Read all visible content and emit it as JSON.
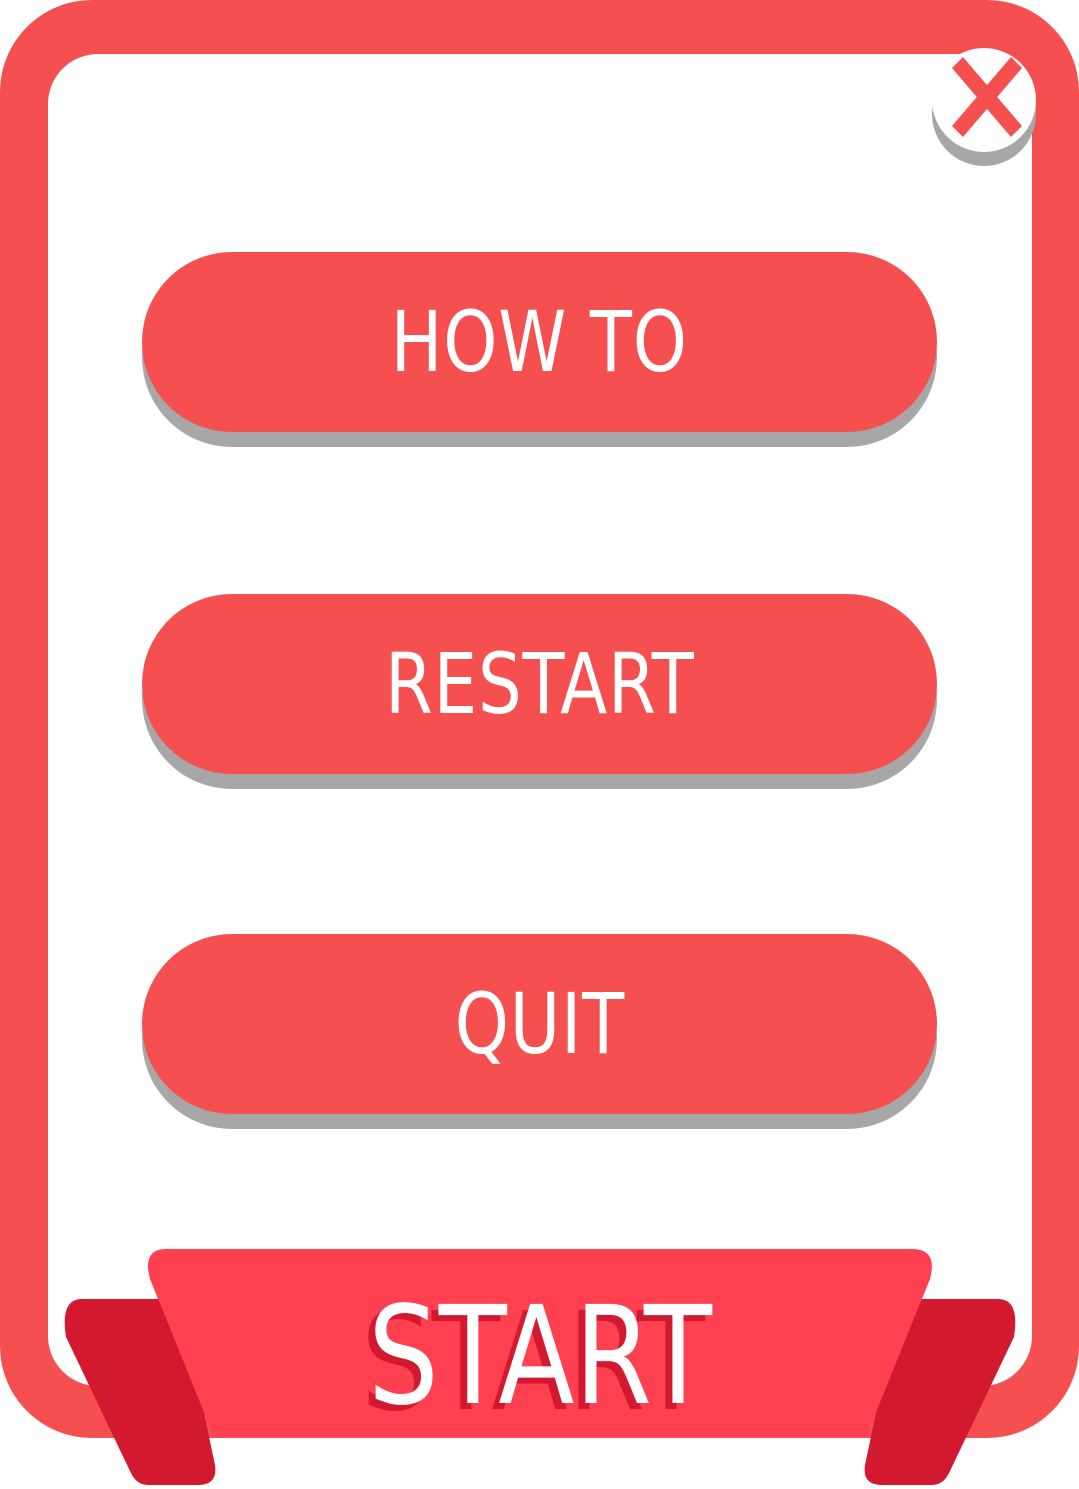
{
  "menu": {
    "buttons": [
      {
        "label": "HOW TO"
      },
      {
        "label": "RESTART"
      },
      {
        "label": "QUIT"
      }
    ]
  },
  "banner": {
    "label": "START"
  },
  "close": {
    "icon": "close-icon"
  },
  "colors": {
    "primary": "#f64f4f",
    "banner": "#fe4050",
    "banner_fold": "#d2192f",
    "button_shadow": "#a7a7a7",
    "panel": "#ffffff"
  }
}
